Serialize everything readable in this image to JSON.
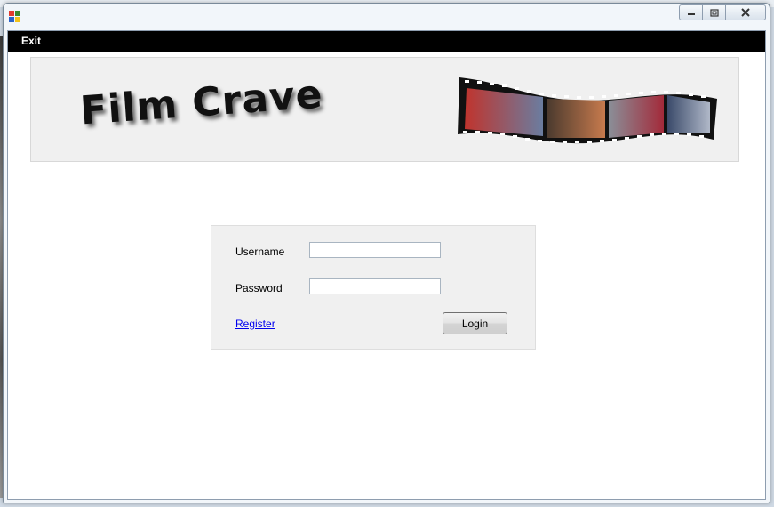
{
  "menu": {
    "exit_label": "Exit"
  },
  "banner": {
    "title": "Film Crave"
  },
  "login": {
    "username_label": "Username",
    "username_value": "",
    "password_label": "Password",
    "password_value": "",
    "register_label": "Register",
    "login_button_label": "Login"
  },
  "icons": {
    "app": "app-icon",
    "minimize": "minimize-icon",
    "maximize": "maximize-icon",
    "close": "close-icon",
    "banner_image": "filmstrip-image"
  },
  "colors": {
    "menubar": "#000000",
    "link": "#0000ee",
    "panel": "#f0f0f0"
  }
}
